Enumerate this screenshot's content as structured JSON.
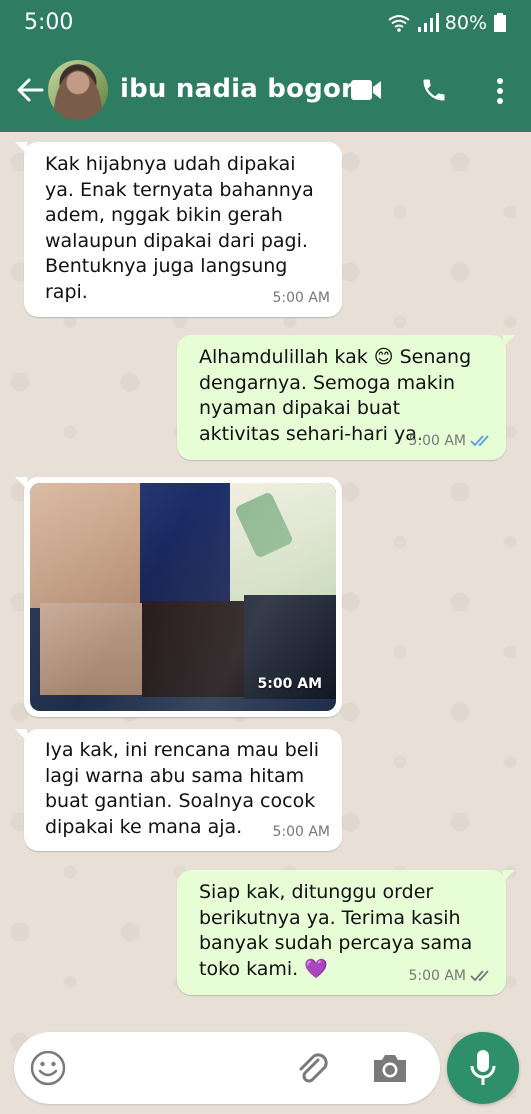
{
  "status": {
    "time": "5:00",
    "battery": "80%"
  },
  "header": {
    "contact_name": "ibu nadia bogor"
  },
  "messages": [
    {
      "dir": "in",
      "text": "Kak hijabnya udah dipakai ya. Enak ternyata bahannya adem, nggak bikin gerah walaupun dipakai dari pagi. Bentuknya juga langsung rapi.",
      "time": "5:00 AM"
    },
    {
      "dir": "out",
      "text": "Alhamdulillah kak 😊 Senang dengarnya. Semoga makin nyaman dipakai buat aktivitas sehari-hari ya.",
      "time": "5:00 AM",
      "read": true
    },
    {
      "dir": "in",
      "type": "image",
      "time": "5:00 AM"
    },
    {
      "dir": "in",
      "text": "Iya kak, ini rencana mau beli lagi warna abu sama hitam buat gantian. Soalnya cocok dipakai ke mana aja.",
      "time": "5:00 AM"
    },
    {
      "dir": "out",
      "text": "Siap kak, ditunggu order berikutnya ya. Terima kasih banyak sudah percaya sama toko kami. 💜",
      "time": "5:00 AM",
      "read": true
    }
  ],
  "colors": {
    "header": "#2e7d62",
    "outgoing": "#e7fdd6",
    "incoming": "#ffffff",
    "ticks": "#4fa3e0"
  }
}
